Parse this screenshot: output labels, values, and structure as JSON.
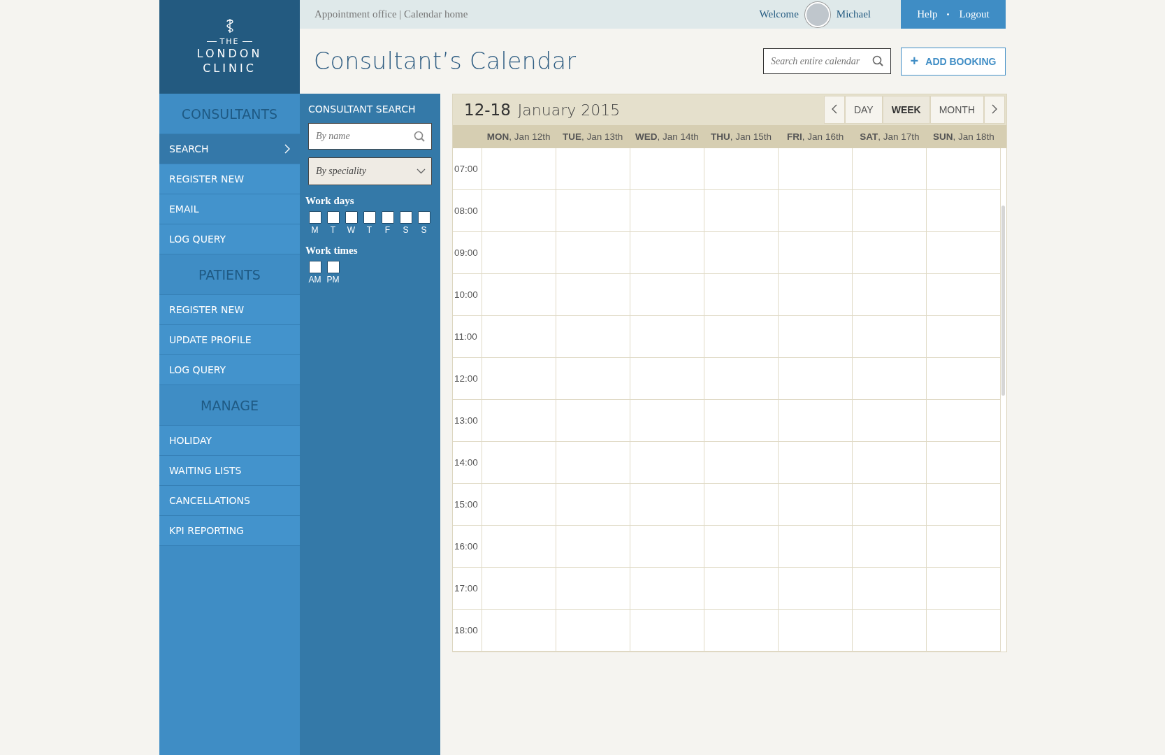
{
  "logo": {
    "top": "THE",
    "line1": "LONDON",
    "line2": "CLINIC"
  },
  "breadcrumb": "Appointment office | Calendar home",
  "user": {
    "welcome": "Welcome",
    "name": "Michael"
  },
  "top_links": [
    "Help",
    "Logout"
  ],
  "page_title": "Consultant’s Calendar",
  "search": {
    "placeholder": "Search entire calendar"
  },
  "add_button": {
    "icon": "+",
    "label": "ADD BOOKING"
  },
  "sidebar": [
    {
      "heading": "CONSULTANTS",
      "items": [
        {
          "label": "SEARCH",
          "selected": true
        },
        {
          "label": "REGISTER NEW",
          "selected": false
        },
        {
          "label": "EMAIL",
          "selected": false
        },
        {
          "label": "LOG QUERY",
          "selected": false
        }
      ]
    },
    {
      "heading": "PATIENTS",
      "items": [
        {
          "label": "REGISTER NEW",
          "selected": false
        },
        {
          "label": "UPDATE PROFILE",
          "selected": false
        },
        {
          "label": "LOG QUERY",
          "selected": false
        }
      ]
    },
    {
      "heading": "MANAGE",
      "items": [
        {
          "label": "HOLIDAY",
          "selected": false
        },
        {
          "label": "WAITING LISTS",
          "selected": false
        },
        {
          "label": "CANCELLATIONS",
          "selected": false
        },
        {
          "label": "KPI REPORTING",
          "selected": false
        }
      ]
    }
  ],
  "consultant_search": {
    "title": "CONSULTANT SEARCH",
    "name_placeholder": "By name",
    "speciality_placeholder": "By speciality",
    "work_days": {
      "label": "Work days",
      "days": [
        {
          "label": "M",
          "checked": false
        },
        {
          "label": "T",
          "checked": false
        },
        {
          "label": "W",
          "checked": false
        },
        {
          "label": "T",
          "checked": false
        },
        {
          "label": "F",
          "checked": false
        },
        {
          "label": "S",
          "checked": false
        },
        {
          "label": "S",
          "checked": false
        }
      ]
    },
    "work_times": {
      "label": "Work times",
      "times": [
        {
          "label": "AM",
          "checked": false
        },
        {
          "label": "PM",
          "checked": false
        }
      ]
    }
  },
  "calendar": {
    "range": "12-18",
    "month": "January 2015",
    "views": [
      {
        "label": "DAY",
        "selected": false
      },
      {
        "label": "WEEK",
        "selected": true
      },
      {
        "label": "MONTH",
        "selected": false
      }
    ],
    "days": [
      "**MON**, Jan 12th",
      "**TUE**, Jan 13th",
      "**WED**, Jan 14th",
      "**THU**, Jan 15th",
      "**FRI**, Jan 16th",
      "**SAT**, Jan 17th",
      "**SUN**, Jan 18th"
    ],
    "times": [
      "07:00",
      "08:00",
      "09:00",
      "10:00",
      "11:00",
      "12:00",
      "13:00",
      "14:00",
      "15:00",
      "16:00",
      "17:00",
      "18:00"
    ]
  }
}
